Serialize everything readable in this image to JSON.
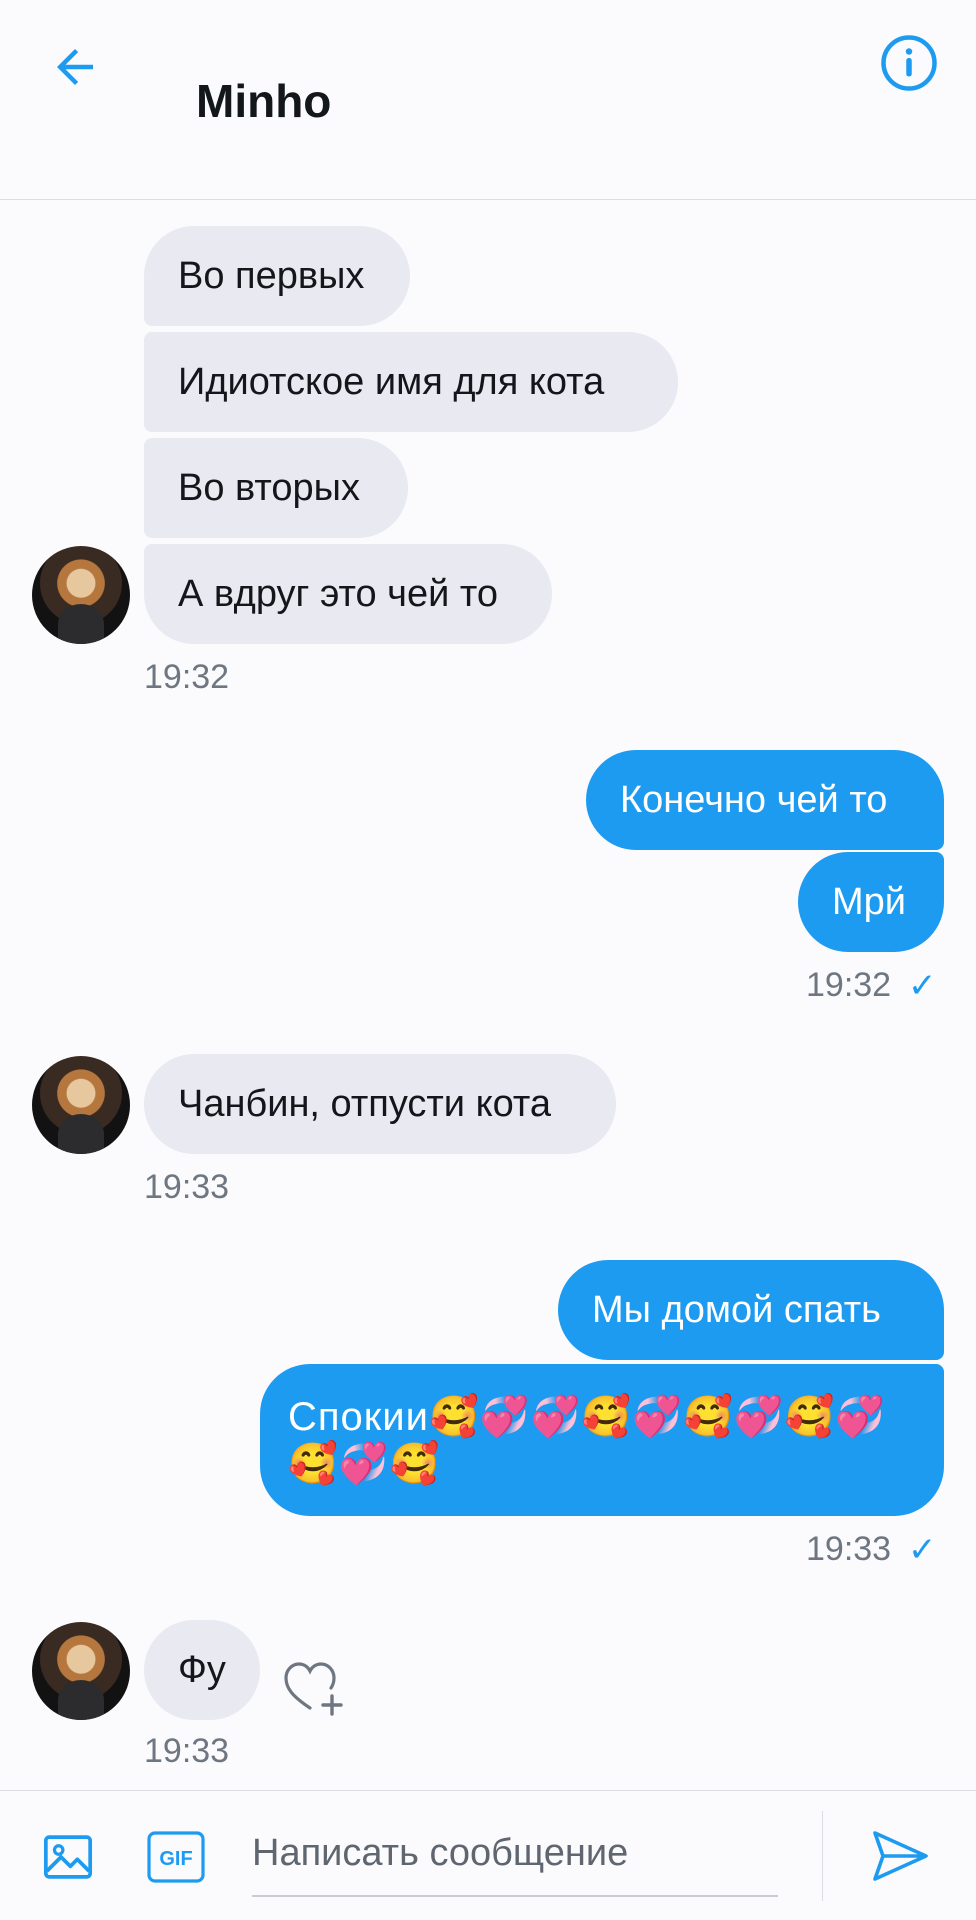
{
  "header": {
    "title": "Minho",
    "back_icon": "arrow-left-icon",
    "info_icon": "info-icon"
  },
  "messages": [
    {
      "from": "Minho",
      "text": "Во первых"
    },
    {
      "from": "Minho",
      "text": "Идиотское имя для кота"
    },
    {
      "from": "Minho",
      "text": "Во вторых"
    },
    {
      "from": "Minho",
      "text": "А вдруг это чей то"
    },
    {
      "from": "Minho",
      "time": "19:32"
    },
    {
      "from": "me",
      "text": "Конечно чей то"
    },
    {
      "from": "me",
      "text": "Мрй"
    },
    {
      "from": "me",
      "time": "19:32",
      "status": "✓"
    },
    {
      "from": "Minho",
      "text": "Чанбин, отпусти кота"
    },
    {
      "from": "Minho",
      "time": "19:33"
    },
    {
      "from": "me",
      "text": "Мы домой спать"
    },
    {
      "from": "me",
      "text_line1": "Спокии🥰💞💞🥰💞🥰💞🥰💞",
      "text_line2": "🥰💞🥰"
    },
    {
      "from": "me",
      "time": "19:33",
      "status": "✓"
    },
    {
      "from": "Minho",
      "text": "Фу"
    },
    {
      "from": "Minho",
      "time": "19:33"
    }
  ],
  "composer": {
    "placeholder": "Написать сообщение",
    "gif_label": "GIF",
    "media_icon": "image-icon",
    "send_icon": "send-icon"
  },
  "colors": {
    "accent": "#1d9bf0",
    "received_bubble": "#e8e9f1",
    "background": "#fbfbfd"
  }
}
